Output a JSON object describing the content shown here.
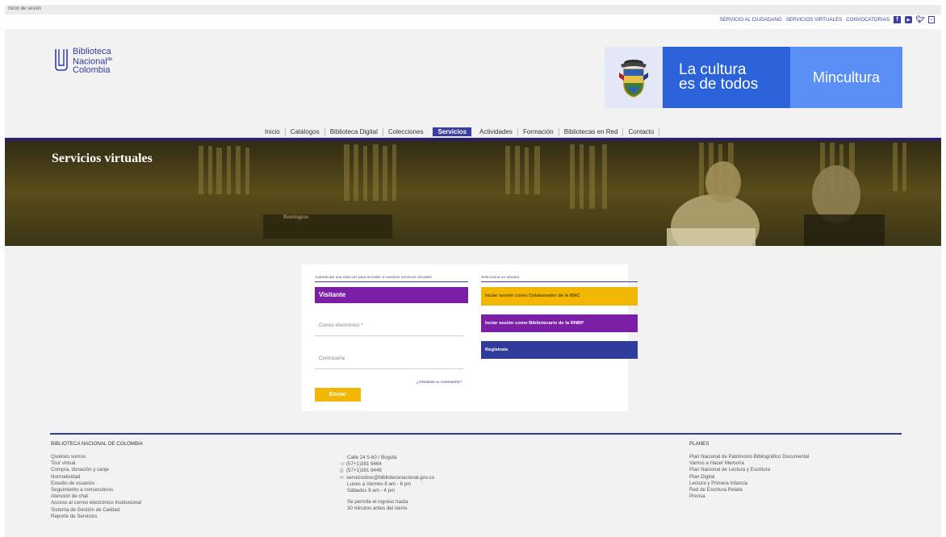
{
  "tab": {
    "title": "Inicio de sesión"
  },
  "top_links": [
    {
      "label": "SERVICIO AL CIUDADANO"
    },
    {
      "label": "SERVICIOS VIRTUALES"
    },
    {
      "label": "CONVOCATORIAS"
    }
  ],
  "social_icons": [
    "facebook-icon",
    "youtube-icon",
    "twitter-icon",
    "flickr-icon"
  ],
  "logo": {
    "line1": "Biblioteca",
    "line2": "Nacional",
    "line2_sup": "de",
    "line3": "Colombia"
  },
  "banner": {
    "cultura_line1": "La cultura",
    "cultura_line2": "es de todos",
    "mincultura": "Mincultura"
  },
  "nav": {
    "items": [
      {
        "label": "Inicio"
      },
      {
        "label": "Catálogos"
      },
      {
        "label": "Biblioteca Digital"
      },
      {
        "label": "Colecciones"
      },
      {
        "label": "Servicios"
      },
      {
        "label": "Actividades"
      },
      {
        "label": "Formación"
      },
      {
        "label": "Bibliotecas en Red"
      },
      {
        "label": "Contacto"
      }
    ],
    "active": "Servicios"
  },
  "hero": {
    "title": "Servicios virtuales",
    "sign_text": "Remington"
  },
  "login": {
    "hint": "Autentícate una sola vez para acceder a nuestros servicios virtuales.",
    "visitor_label": "Visitante",
    "email_placeholder": "Correo electrónico *",
    "password_placeholder": "Contraseña",
    "forgot": "¿Olvidaste tu contraseña?",
    "submit": "Enviar"
  },
  "user_select": {
    "hint": "Selecciona un usuario",
    "collab": "Inciar sesión como Colaborador de la BNC",
    "rnbp": "Inciar sesión como Bibliotecario de la RNBP",
    "register": "Regístrate"
  },
  "footer": {
    "org_title": "BIBLIOTECA NACIONAL DE COLOMBIA",
    "org_links": [
      "Quiénes somos",
      "Tour virtual",
      "Compra, donación y canje",
      "Normatividad",
      "Estudio de usuarios",
      "Seguimiento a consecutivos",
      "Atención de chat",
      "Acceso al correo electrónico Institucional",
      "Sistema de Gestión de Calidad",
      "Reporte de Servicios"
    ],
    "address": "Calle 24 5-60 / Bogotá",
    "phone": "(57+1)381 6464",
    "fax": "(57+1)381 6449",
    "email": "serviciosbnc@bibliotecanacional.gov.co",
    "hours1": "Lunes a Viernes 8 am - 6 pm",
    "hours2": "Sábados 9 am - 4 pm",
    "note1": "Se permite el ingreso hasta",
    "note2": "30 minutos antes del cierre.",
    "plans_title": "PLANES",
    "plans": [
      "Plan Nacional de Patrimonio Bibliográfico Documental",
      "Vamos a Hacer Memoria",
      "Plan Nacional de Lectura y Escritura",
      "Plan Digital",
      "Lectura y Primera Infancia",
      "Red de Escritura Relata",
      "Prensa"
    ]
  },
  "colors": {
    "primary": "#3a3fa3",
    "purple": "#7a1fa6",
    "yellow": "#f2b705",
    "blue_banner": "#2b62d9"
  }
}
